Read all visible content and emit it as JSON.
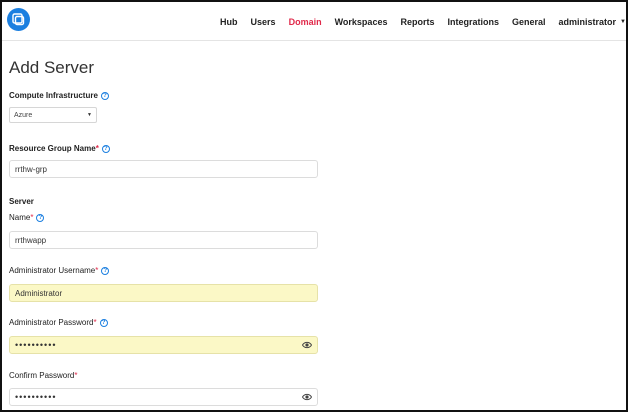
{
  "nav": {
    "items": [
      {
        "label": "Hub",
        "active": false
      },
      {
        "label": "Users",
        "active": false
      },
      {
        "label": "Domain",
        "active": true
      },
      {
        "label": "Workspaces",
        "active": false
      },
      {
        "label": "Reports",
        "active": false
      },
      {
        "label": "Integrations",
        "active": false
      },
      {
        "label": "General",
        "active": false
      }
    ],
    "user": "administrator",
    "active_color": "#e0294a"
  },
  "logo": {
    "icon": "app-logo-icon",
    "color": "#1b7fe0"
  },
  "page": {
    "title": "Add Server"
  },
  "form": {
    "compute_infrastructure": {
      "label": "Compute Infrastructure",
      "value": "Azure"
    },
    "resource_group": {
      "label": "Resource Group Name",
      "required": "*",
      "value": "rrthw-grp"
    },
    "server_section": "Server",
    "name": {
      "label": "Name",
      "required": "*",
      "value": "rrthwapp"
    },
    "admin_username": {
      "label": "Administrator Username",
      "required": "*",
      "value": "Administrator"
    },
    "admin_password": {
      "label": "Administrator Password",
      "required": "*",
      "value": "••••••••••"
    },
    "confirm_password": {
      "label": "Confirm Password",
      "required": "*",
      "value": "••••••••••"
    },
    "help_icon": "?",
    "autofill_color": "#fbf8c6"
  }
}
